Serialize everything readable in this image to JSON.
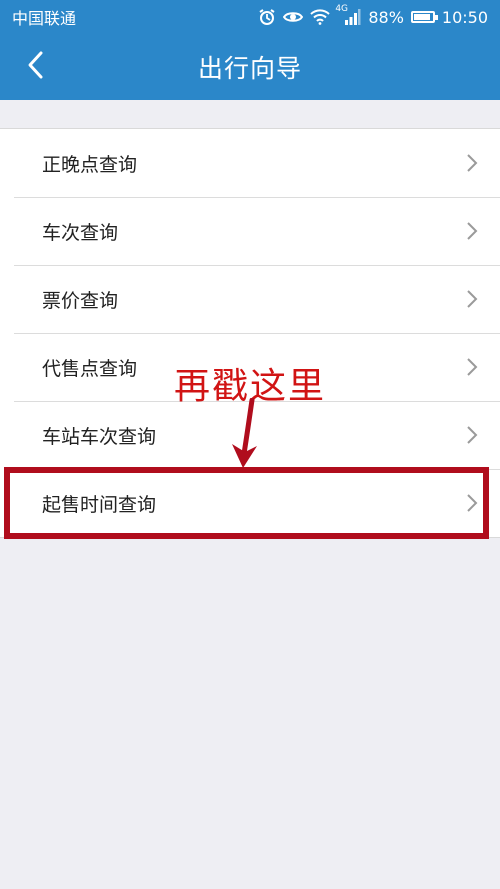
{
  "status_bar": {
    "carrier": "中国联通",
    "network_label": "4G",
    "battery_percent": "88%",
    "battery_level": 0.88,
    "time": "10:50"
  },
  "nav": {
    "title": "出行向导",
    "back_icon": "chevron-left-icon"
  },
  "menu": {
    "items": [
      {
        "label": "正晚点查询"
      },
      {
        "label": "车次查询"
      },
      {
        "label": "票价查询"
      },
      {
        "label": "代售点查询"
      },
      {
        "label": "车站车次查询"
      },
      {
        "label": "起售时间查询"
      }
    ],
    "chevron_icon": "chevron-right-icon"
  },
  "annotation": {
    "text": "再戳这里",
    "color": "#d11414",
    "highlighted_item": "起售时间查询"
  },
  "colors": {
    "header": "#2b87c9",
    "background": "#eeeef3",
    "highlight_border": "#b00d1d"
  }
}
